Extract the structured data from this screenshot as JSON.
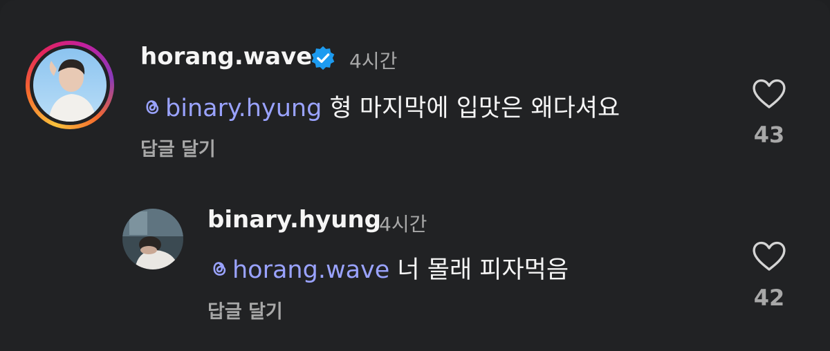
{
  "comments": [
    {
      "username": "horang.wave",
      "verified": true,
      "time": "4시간",
      "mention": "binary.hyung",
      "text": "형 마지막에 입맛은 왜다셔요",
      "reply_label": "답글 달기",
      "likes": "43",
      "avatar_story_ring": true
    },
    {
      "username": "binary.hyung",
      "verified": false,
      "time": "4시간",
      "mention": "horang.wave",
      "text": "너 몰래 피자먹음",
      "reply_label": "답글 달기",
      "likes": "42",
      "avatar_story_ring": false
    }
  ],
  "icons": {
    "verified": "verified-badge-icon",
    "mention": "threads-at-icon",
    "like": "heart-outline-icon"
  },
  "colors": {
    "background": "#212224",
    "mention": "#9aa3ff",
    "verified": "#1d9bf0",
    "secondary_text": "#a8a8a8"
  }
}
